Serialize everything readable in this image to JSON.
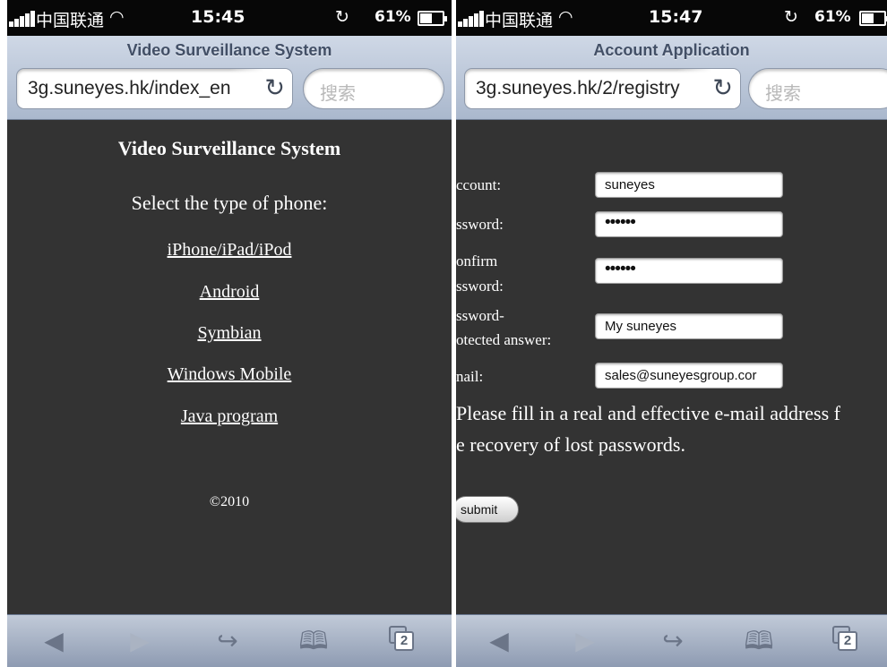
{
  "left_screen": {
    "status_bar": {
      "carrier": "中国联通",
      "time": "15:45",
      "battery": "61%"
    },
    "browser": {
      "page_title": "Video Surveillance System",
      "address": "3g.suneyes.hk/index_en",
      "search_placeholder": "搜索"
    },
    "page": {
      "heading": "Video Surveillance System",
      "prompt": "Select the type of phone:",
      "links": [
        "iPhone/iPad/iPod",
        "Android",
        "Symbian",
        "Windows Mobile",
        "Java program"
      ],
      "copyright": "©2010"
    },
    "toolbar": {
      "tab_count": "2"
    }
  },
  "right_screen": {
    "status_bar": {
      "carrier": "中国联通",
      "time": "15:47",
      "battery": "61%"
    },
    "browser": {
      "page_title": "Account Application",
      "address": "3g.suneyes.hk/2/registry",
      "search_placeholder": "搜索"
    },
    "form": {
      "account_label": "ccount:",
      "account_value": "suneyes",
      "password_label": "ssword:",
      "password_value": "••••••",
      "confirm_label_1": "onfirm",
      "confirm_label_2": "ssword:",
      "confirm_value": "••••••",
      "answer_label_1": "ssword-",
      "answer_label_2": "otected answer:",
      "answer_value": "My suneyes",
      "email_label": "nail:",
      "email_value": "sales@suneyesgroup.cor",
      "help_line_1": "Please fill in a real and effective e-mail address f",
      "help_line_2": "e recovery of lost passwords.",
      "submit_label": "submit"
    },
    "toolbar": {
      "tab_count": "2"
    }
  },
  "icons": {
    "status": [
      "signal-bars-icon",
      "wifi-icon",
      "orientation-lock-icon",
      "battery-icon"
    ],
    "browser": [
      "reload-icon"
    ],
    "toolbar": [
      "back-arrow-icon",
      "forward-arrow-icon",
      "share-icon",
      "bookmarks-icon",
      "tabs-icon"
    ]
  },
  "colors": {
    "page_background": "#333333",
    "status_bar": "#070707",
    "browser_chrome": "#aab8cd",
    "title_text": "#424f66"
  }
}
